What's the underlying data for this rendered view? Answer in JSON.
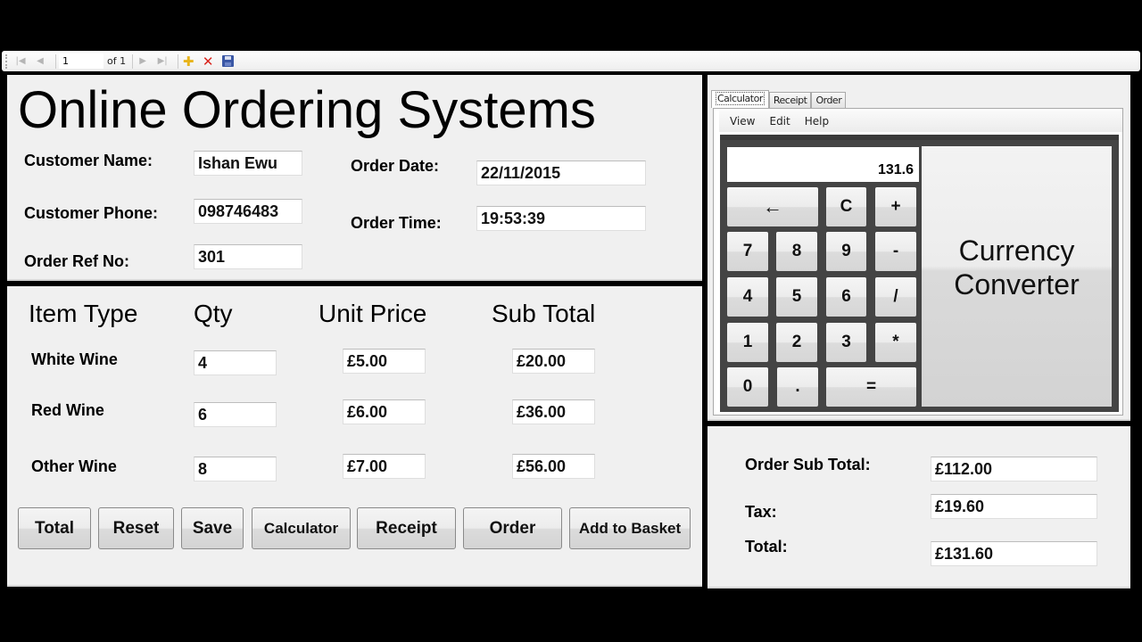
{
  "toolbar": {
    "page_value": "1",
    "of_label": "of 1",
    "icons": [
      "first-page-icon",
      "previous-page-icon",
      "next-page-icon",
      "last-page-icon",
      "add-icon",
      "delete-icon",
      "save-icon"
    ]
  },
  "header": {
    "title": "Online Ordering Systems",
    "customer_name_label": "Customer Name:",
    "customer_name_value": "Ishan Ewu",
    "customer_phone_label": "Customer Phone:",
    "customer_phone_value": "098746483",
    "order_ref_label": "Order Ref No:",
    "order_ref_value": "301",
    "order_date_label": "Order Date:",
    "order_date_value": "22/11/2015",
    "order_time_label": "Order Time:",
    "order_time_value": "19:53:39"
  },
  "items": {
    "columns": [
      "Item Type",
      "Qty",
      "Unit Price",
      "Sub Total"
    ],
    "rows": [
      {
        "item": "White Wine",
        "qty": "4",
        "unit_price": "£5.00",
        "sub_total": "£20.00"
      },
      {
        "item": "Red Wine",
        "qty": "6",
        "unit_price": "£6.00",
        "sub_total": "£36.00"
      },
      {
        "item": "Other Wine",
        "qty": "8",
        "unit_price": "£7.00",
        "sub_total": "£56.00"
      }
    ]
  },
  "buttons": {
    "total": "Total",
    "reset": "Reset",
    "save": "Save",
    "calculator": "Calculator",
    "receipt": "Receipt",
    "order": "Order",
    "add_to_basket": "Add to Basket"
  },
  "tabs": [
    "Calculator",
    "Receipt",
    "Order"
  ],
  "active_tab": "Calculator",
  "menu": [
    "View",
    "Edit",
    "Help"
  ],
  "calculator": {
    "display": "131.6",
    "keys": {
      "backspace": "←",
      "clear": "C",
      "plus": "+",
      "seven": "7",
      "eight": "8",
      "nine": "9",
      "minus": "-",
      "four": "4",
      "five": "5",
      "six": "6",
      "divide": "/",
      "one": "1",
      "two": "2",
      "three": "3",
      "multiply": "*",
      "zero": "0",
      "decimal": ".",
      "equals": "="
    },
    "currency_converter": "Currency Converter"
  },
  "totals": {
    "sub_total_label": "Order Sub Total:",
    "sub_total_value": "£112.00",
    "tax_label": "Tax:",
    "tax_value": "£19.60",
    "total_label": "Total:",
    "total_value": "£131.60"
  }
}
